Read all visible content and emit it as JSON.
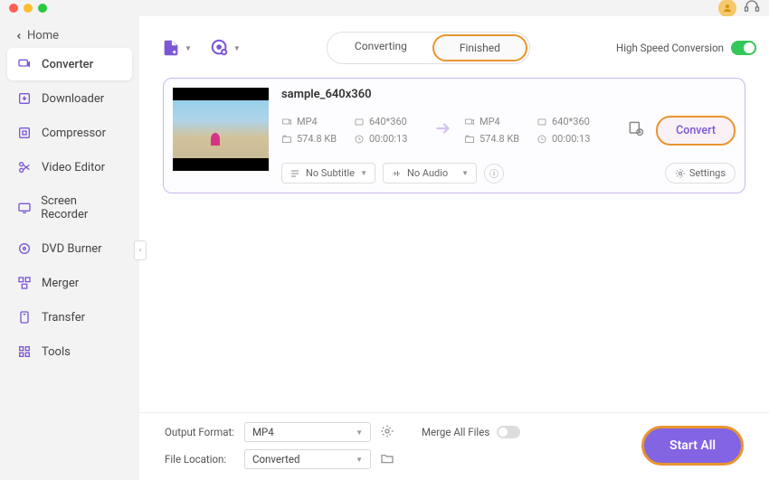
{
  "home_label": "Home",
  "sidebar": {
    "items": [
      {
        "label": "Converter"
      },
      {
        "label": "Downloader"
      },
      {
        "label": "Compressor"
      },
      {
        "label": "Video Editor"
      },
      {
        "label": "Screen Recorder"
      },
      {
        "label": "DVD Burner"
      },
      {
        "label": "Merger"
      },
      {
        "label": "Transfer"
      },
      {
        "label": "Tools"
      }
    ]
  },
  "tabs": {
    "converting": "Converting",
    "finished": "Finished"
  },
  "high_speed_label": "High Speed Conversion",
  "file": {
    "title": "sample_640x360",
    "src": {
      "format": "MP4",
      "res": "640*360",
      "size": "574.8 KB",
      "dur": "00:00:13"
    },
    "dst": {
      "format": "MP4",
      "res": "640*360",
      "size": "574.8 KB",
      "dur": "00:00:13"
    },
    "subtitle": "No Subtitle",
    "audio": "No Audio",
    "convert_label": "Convert",
    "settings_label": "Settings"
  },
  "footer": {
    "output_format_label": "Output Format:",
    "output_format_value": "MP4",
    "file_location_label": "File Location:",
    "file_location_value": "Converted",
    "merge_label": "Merge All Files",
    "start_all_label": "Start All"
  },
  "info_char": "ⓘ"
}
